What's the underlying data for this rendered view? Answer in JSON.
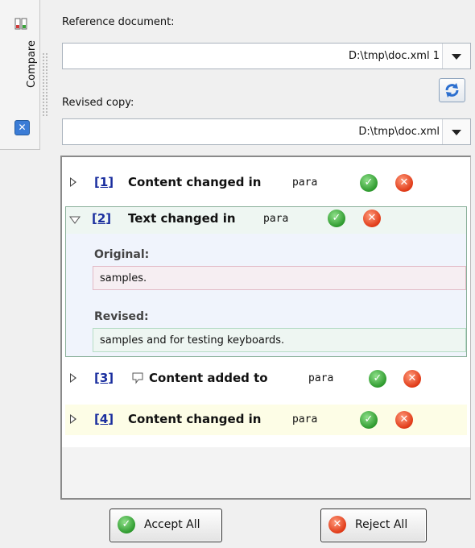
{
  "sidebar": {
    "tab_label": "Compare",
    "close_glyph": "✕"
  },
  "reference": {
    "label": "Reference document:",
    "value": "D:\\tmp\\doc.xml 1"
  },
  "revised_copy": {
    "label": "Revised copy:",
    "value": "D:\\tmp\\doc.xml"
  },
  "changes": [
    {
      "num": "[1]",
      "text": "Content changed in",
      "element": "para",
      "expanded": false
    },
    {
      "num": "[2]",
      "text": "Text changed in",
      "element": "para",
      "expanded": true,
      "original_label": "Original:",
      "original_text": "samples.",
      "revised_label": "Revised:",
      "revised_text": "samples and for testing keyboards."
    },
    {
      "num": "[3]",
      "text": "Content added to",
      "element": "para",
      "expanded": false,
      "has_comment": true
    },
    {
      "num": "[4]",
      "text": "Content changed in",
      "element": "para",
      "expanded": false
    }
  ],
  "icons": {
    "accept": "check-circle-icon",
    "reject": "x-circle-icon",
    "refresh": "refresh-icon",
    "comment": "comment-bubble-icon"
  },
  "buttons": {
    "accept_all": "Accept All",
    "reject_all": "Reject All"
  },
  "colors": {
    "accept": "#2e9a2e",
    "reject": "#e03a17",
    "link": "#1a2e9e"
  }
}
